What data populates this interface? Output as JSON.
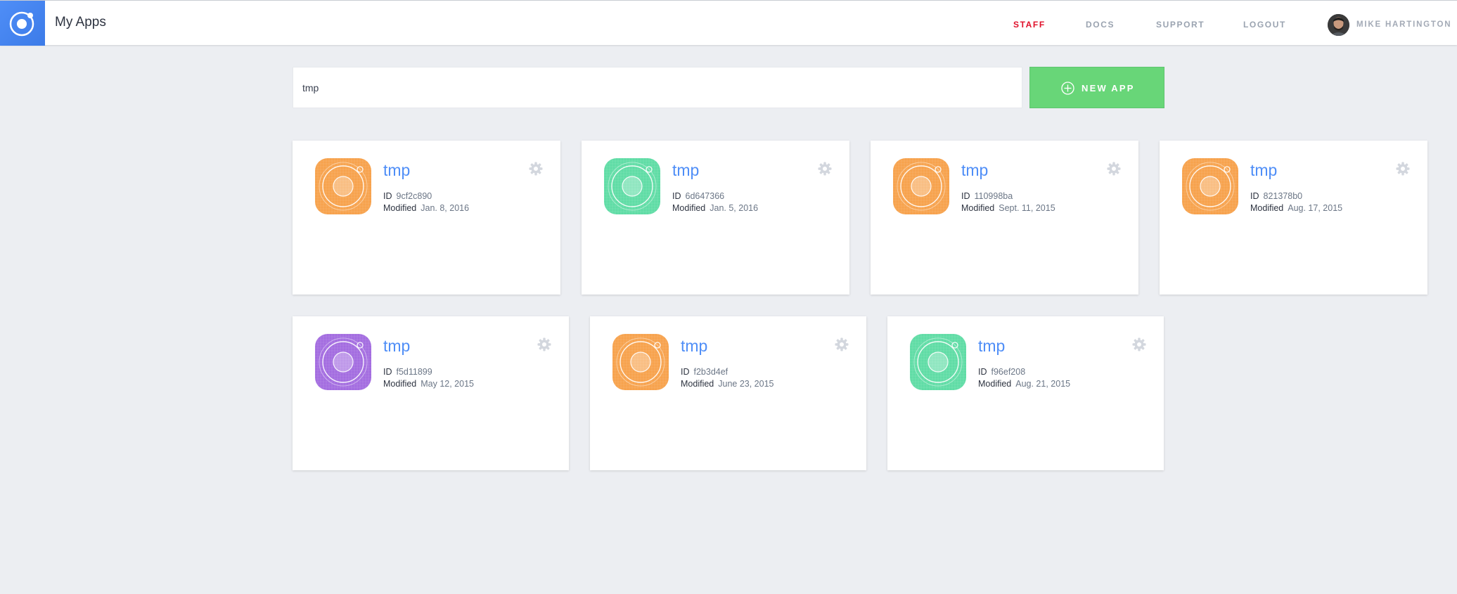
{
  "header": {
    "app_title": "My Apps",
    "nav": [
      {
        "label": "STAFF",
        "active": true
      },
      {
        "label": "DOCS",
        "active": false
      },
      {
        "label": "SUPPORT",
        "active": false
      },
      {
        "label": "LOGOUT",
        "active": false
      }
    ],
    "user_name": "MIKE HARTINGTON"
  },
  "search": {
    "value": "tmp"
  },
  "new_app_label": "NEW APP",
  "meta_labels": {
    "id": "ID",
    "modified": "Modified"
  },
  "colors": {
    "orange": "#f7a24c",
    "green": "#5fdca5",
    "purple": "#a36ce0",
    "accent_blue": "#4f8ef7",
    "staff_red": "#e0102a",
    "new_app_green": "#68d678"
  },
  "apps": [
    {
      "name": "tmp",
      "id": "9cf2c890",
      "modified": "Jan. 8, 2016",
      "color": "orange"
    },
    {
      "name": "tmp",
      "id": "6d647366",
      "modified": "Jan. 5, 2016",
      "color": "green"
    },
    {
      "name": "tmp",
      "id": "110998ba",
      "modified": "Sept. 11, 2015",
      "color": "orange"
    },
    {
      "name": "tmp",
      "id": "821378b0",
      "modified": "Aug. 17, 2015",
      "color": "orange"
    },
    {
      "name": "tmp",
      "id": "f5d11899",
      "modified": "May 12, 2015",
      "color": "purple"
    },
    {
      "name": "tmp",
      "id": "f2b3d4ef",
      "modified": "June 23, 2015",
      "color": "orange"
    },
    {
      "name": "tmp",
      "id": "f96ef208",
      "modified": "Aug. 21, 2015",
      "color": "green"
    }
  ]
}
